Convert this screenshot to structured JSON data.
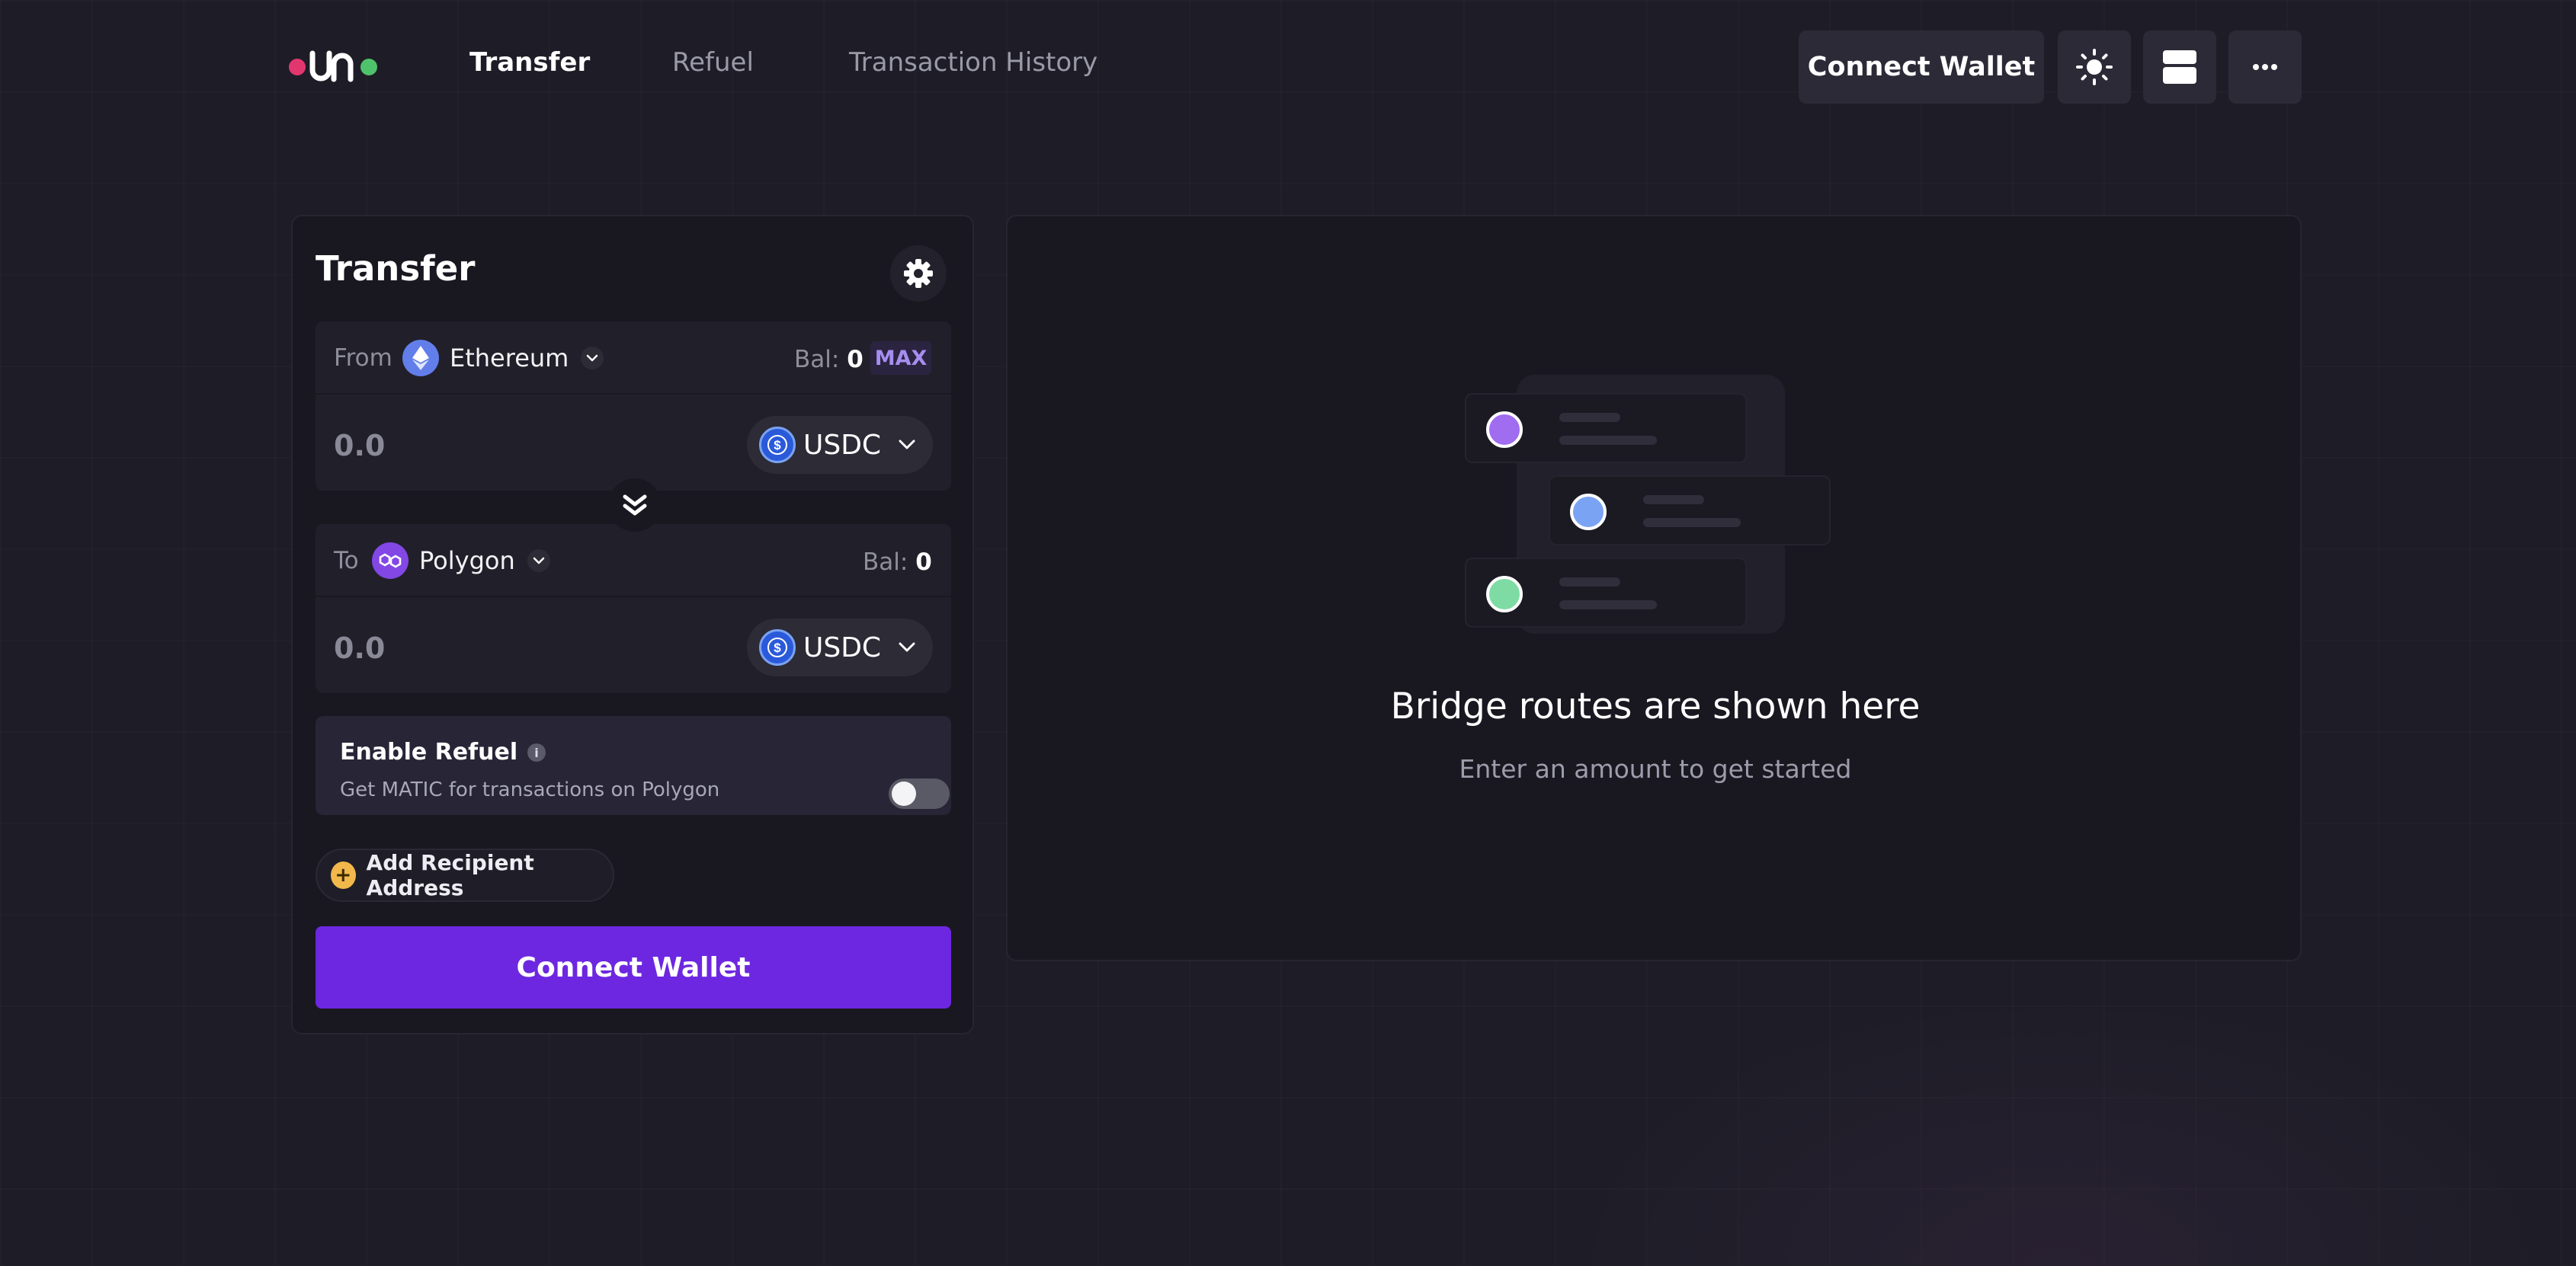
{
  "header": {
    "nav": [
      {
        "label": "Transfer",
        "active": true
      },
      {
        "label": "Refuel",
        "active": false
      },
      {
        "label": "Transaction History",
        "active": false
      }
    ],
    "connect_wallet_label": "Connect Wallet",
    "icons": [
      "sun-icon",
      "layout-icon",
      "more-icon"
    ]
  },
  "transfer": {
    "title": "Transfer",
    "from": {
      "label": "From",
      "chain": "Ethereum",
      "bal_label": "Bal:",
      "bal_value": "0",
      "max_label": "MAX",
      "amount_placeholder": "0.0",
      "token": "USDC"
    },
    "to": {
      "label": "To",
      "chain": "Polygon",
      "bal_label": "Bal:",
      "bal_value": "0",
      "amount_placeholder": "0.0",
      "token": "USDC"
    },
    "refuel": {
      "title": "Enable Refuel",
      "info": "i",
      "subtitle": "Get MATIC for transactions on Polygon",
      "enabled": false
    },
    "recipient_label": "Add Recipient Address",
    "connect_label": "Connect Wallet"
  },
  "routes": {
    "title": "Bridge routes are shown here",
    "subtitle": "Enter an amount to get started"
  },
  "colors": {
    "accent": "#6d27e0",
    "ethereum": "#627eea",
    "polygon": "#8247e5",
    "usdc": "#2a5ada",
    "route_dot_purple": "#a06cf0",
    "route_dot_blue": "#7ba3f3",
    "route_dot_green": "#7fdba4"
  }
}
